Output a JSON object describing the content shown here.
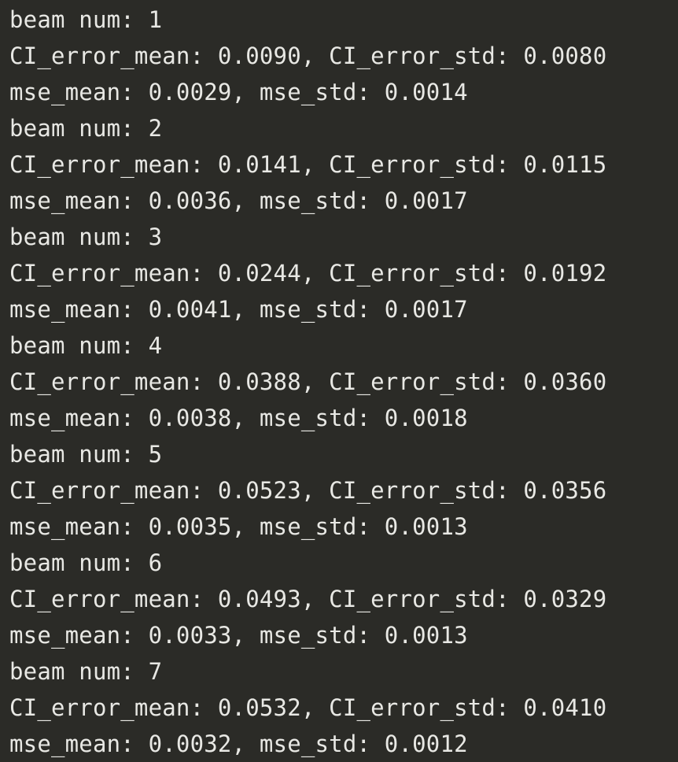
{
  "colors": {
    "background": "#2b2b27",
    "text": "#e8e8e4"
  },
  "lines": [
    "beam num: 1",
    "CI_error_mean: 0.0090, CI_error_std: 0.0080",
    "mse_mean: 0.0029, mse_std: 0.0014",
    "beam num: 2",
    "CI_error_mean: 0.0141, CI_error_std: 0.0115",
    "mse_mean: 0.0036, mse_std: 0.0017",
    "beam num: 3",
    "CI_error_mean: 0.0244, CI_error_std: 0.0192",
    "mse_mean: 0.0041, mse_std: 0.0017",
    "beam num: 4",
    "CI_error_mean: 0.0388, CI_error_std: 0.0360",
    "mse_mean: 0.0038, mse_std: 0.0018",
    "beam num: 5",
    "CI_error_mean: 0.0523, CI_error_std: 0.0356",
    "mse_mean: 0.0035, mse_std: 0.0013",
    "beam num: 6",
    "CI_error_mean: 0.0493, CI_error_std: 0.0329",
    "mse_mean: 0.0033, mse_std: 0.0013",
    "beam num: 7",
    "CI_error_mean: 0.0532, CI_error_std: 0.0410",
    "mse_mean: 0.0032, mse_std: 0.0012"
  ]
}
